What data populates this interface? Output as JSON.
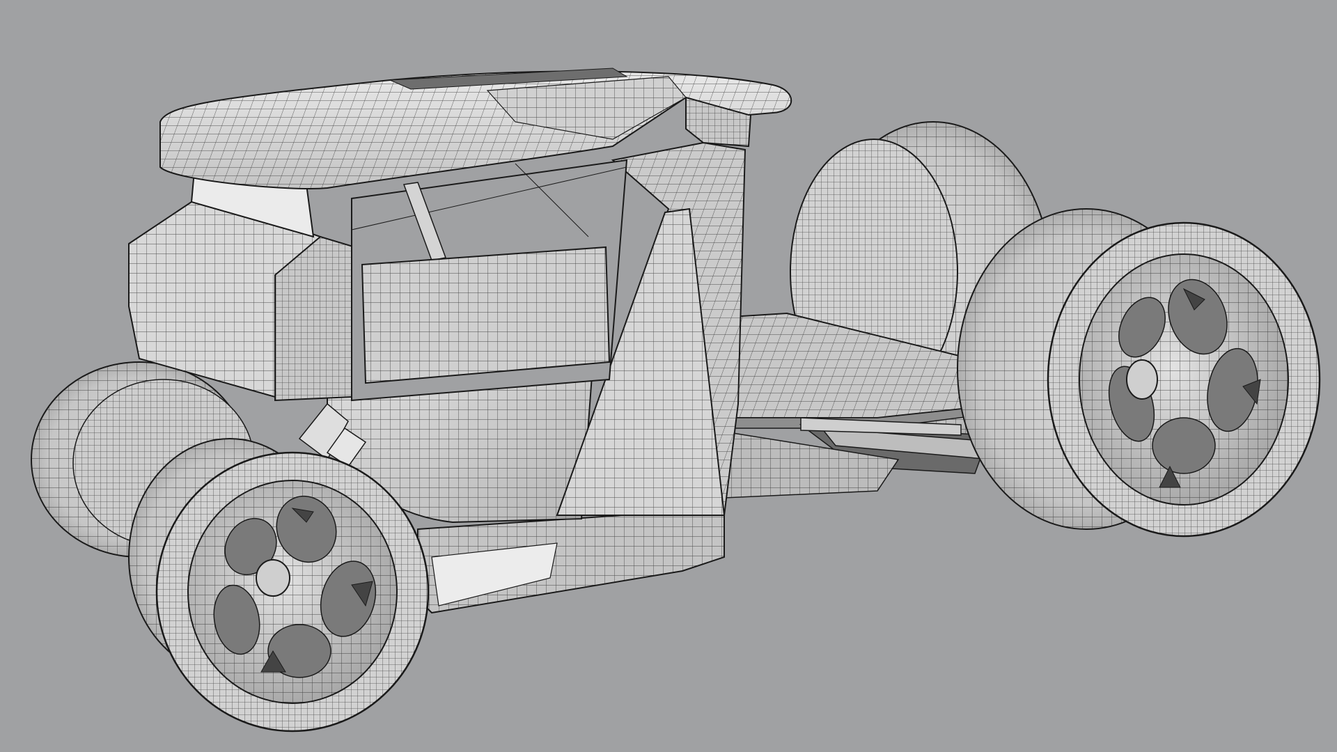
{
  "viewport": {
    "background": "#a0a1a3",
    "shading": {
      "light": "#e6e6e6",
      "mid": "#c9c9c9",
      "dark": "#8e8e8e",
      "deep": "#6a6a6a",
      "wire": "#1a1a1a"
    },
    "model": {
      "icon": "hot-rod-wireframe-model",
      "parts": [
        "roof",
        "cab",
        "hood",
        "side-pillar",
        "rear-deck",
        "exhaust-pipes",
        "front-wheel-near",
        "front-wheel-far",
        "rear-wheel-near",
        "rear-wheel-far"
      ]
    }
  }
}
